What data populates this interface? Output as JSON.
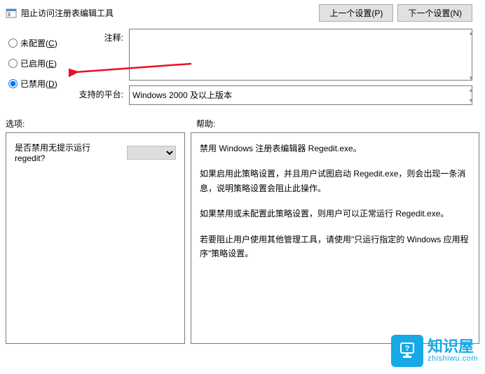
{
  "header": {
    "title": "阻止访问注册表编辑工具",
    "prev_btn": "上一个设置(P)",
    "next_btn": "下一个设置(N)"
  },
  "radios": {
    "not_configured": "未配置",
    "not_configured_key": "C",
    "enabled": "已启用",
    "enabled_key": "E",
    "disabled": "已禁用",
    "disabled_key": "D"
  },
  "labels": {
    "comment": "注释:",
    "platform": "支持的平台:",
    "options": "选项:",
    "help": "帮助:"
  },
  "fields": {
    "comment_value": "",
    "platform_value": "Windows 2000 及以上版本"
  },
  "options": {
    "question": "是否禁用无提示运行 regedit?",
    "dropdown_value": ""
  },
  "help": {
    "p1": "禁用 Windows 注册表编辑器 Regedit.exe。",
    "p2": "如果启用此策略设置，并且用户试图启动 Regedit.exe，则会出现一条消息，说明策略设置会阻止此操作。",
    "p3": "如果禁用或未配置此策略设置，则用户可以正常运行 Regedit.exe。",
    "p4": "若要阻止用户使用其他管理工具，请使用\"只运行指定的 Windows 应用程序\"策略设置。"
  },
  "watermark": {
    "main": "知识屋",
    "sub": "zhishiwu.com"
  }
}
